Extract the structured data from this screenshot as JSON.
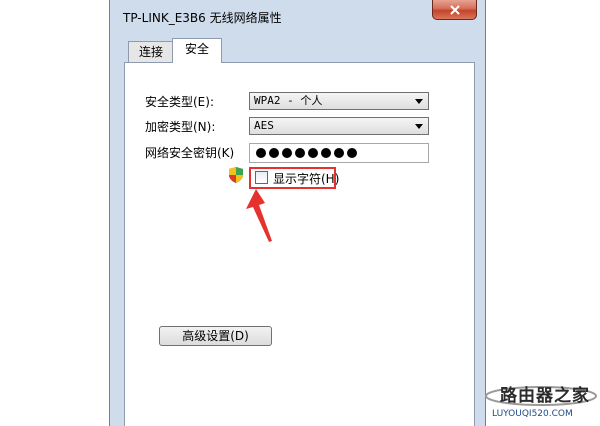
{
  "window": {
    "title": "TP-LINK_E3B6 无线网络属性"
  },
  "tabs": [
    {
      "label": "连接"
    },
    {
      "label": "安全"
    }
  ],
  "security": {
    "type_label": "安全类型(E):",
    "type_value": "WPA2 - 个人",
    "encryption_label": "加密类型(N):",
    "encryption_value": "AES",
    "key_label": "网络安全密钥(K)",
    "key_masked_length": 8,
    "show_chars_label": "显示字符(H)",
    "show_chars_checked": false
  },
  "advanced_button": {
    "label": "高级设置(D)"
  },
  "annotation": {
    "highlight_color": "#e6322e"
  },
  "watermark": {
    "text": "路由器之家",
    "url": "LUYOUQI520.COM"
  }
}
